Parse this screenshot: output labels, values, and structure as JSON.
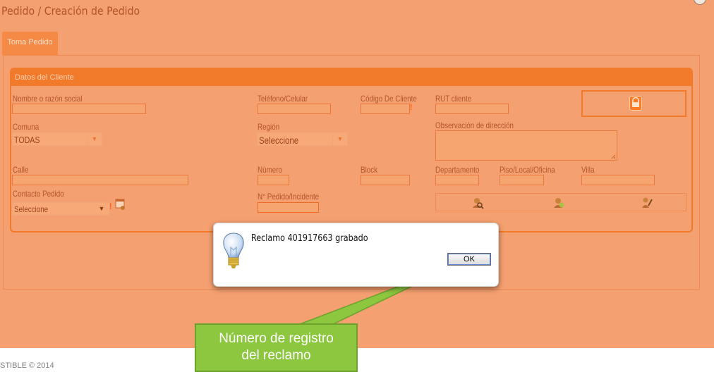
{
  "page_title": "Pedido / Creación de Pedido",
  "close_icon": "close-circle-icon",
  "tab": {
    "label": "Toma Pedido"
  },
  "fieldset": {
    "title": "Datos del Cliente"
  },
  "labels": {
    "nombre": "Nombre o razón social",
    "telefono": "Teléfono/Celular",
    "codigo_cliente": "Código De Cliente",
    "rut_cliente": "RUT cliente",
    "comuna": "Comuna",
    "region": "Región",
    "observacion": "Observación de dirección",
    "calle": "Calle",
    "numero": "Número",
    "block": "Block",
    "departamento": "Departamento",
    "piso": "Piso/Local/Oficina",
    "villa": "Villa",
    "contacto_pedido": "Contacto Pedido",
    "n_pedido": "N° Pedido/Incidente"
  },
  "required_marker": "!",
  "selects": {
    "comuna": "TODAS",
    "region": "Seleccione",
    "contacto": "Seleccione"
  },
  "icons": {
    "lock": "lock-icon",
    "search": "search-user-icon",
    "add": "add-contact-icon",
    "edit": "edit-contact-icon",
    "calendar": "calendar-icon"
  },
  "dialog": {
    "message": "Reclamo 401917663 grabado",
    "ok_label": "OK",
    "icon": "lightbulb-icon"
  },
  "callout": {
    "line1": "Número de registro",
    "line2": "del reclamo"
  },
  "footer": {
    "text": "STIBLE © 2014"
  },
  "colors": {
    "overlay": "#f5a071",
    "accent": "#f27a2b",
    "callout": "#8dc63f"
  }
}
